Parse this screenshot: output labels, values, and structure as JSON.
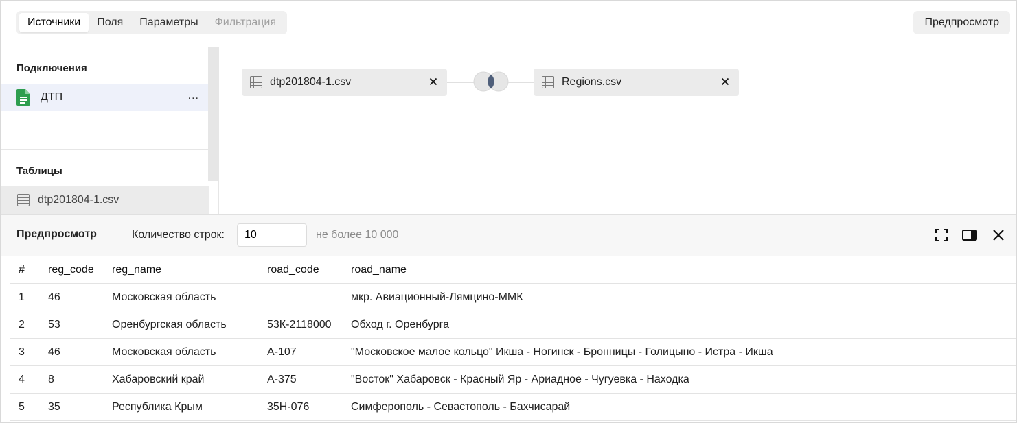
{
  "tabs": [
    {
      "label": "Источники",
      "state": "active"
    },
    {
      "label": "Поля",
      "state": "normal"
    },
    {
      "label": "Параметры",
      "state": "normal"
    },
    {
      "label": "Фильтрация",
      "state": "disabled"
    }
  ],
  "header": {
    "preview_button": "Предпросмотр"
  },
  "sidebar": {
    "connections_title": "Подключения",
    "connection": {
      "label": "ДТП",
      "icon": "spreadsheet-doc-icon",
      "more": "..."
    },
    "tables_title": "Таблицы",
    "table": {
      "label": "dtp201804-1.csv",
      "icon": "table-icon"
    }
  },
  "canvas": {
    "left_node": {
      "label": "dtp201804-1.csv"
    },
    "right_node": {
      "label": "Regions.csv"
    },
    "join_icon": "inner-join-icon"
  },
  "preview": {
    "title": "Предпросмотр",
    "rows_label": "Количество строк:",
    "rows_value": "10",
    "rows_hint": "не более 10 000",
    "icons": [
      "fullscreen-icon",
      "panel-layout-icon",
      "close-icon"
    ]
  },
  "table": {
    "columns": [
      "#",
      "reg_code",
      "reg_name",
      "road_code",
      "road_name"
    ],
    "rows": [
      [
        "1",
        "46",
        "Московская область",
        "",
        "мкр. Авиационный-Лямцино-ММК"
      ],
      [
        "2",
        "53",
        "Оренбургская область",
        "53К-2118000",
        "Обход г. Оренбурга"
      ],
      [
        "3",
        "46",
        "Московская область",
        "А-107",
        "\"Московское малое кольцо\" Икша - Ногинск - Бронницы - Голицыно - Истра - Икша"
      ],
      [
        "4",
        "8",
        "Хабаровский край",
        "А-375",
        "\"Восток\" Хабаровск - Красный Яр - Ариадное - Чугуевка - Находка"
      ],
      [
        "5",
        "35",
        "Республика Крым",
        "35Н-076",
        "Симферополь - Севастополь - Бахчисарай"
      ]
    ]
  },
  "colors": {
    "accent_green": "#2e9e4f",
    "selected_bg": "#eef1fa",
    "panel_bg": "#f0f0f0"
  }
}
